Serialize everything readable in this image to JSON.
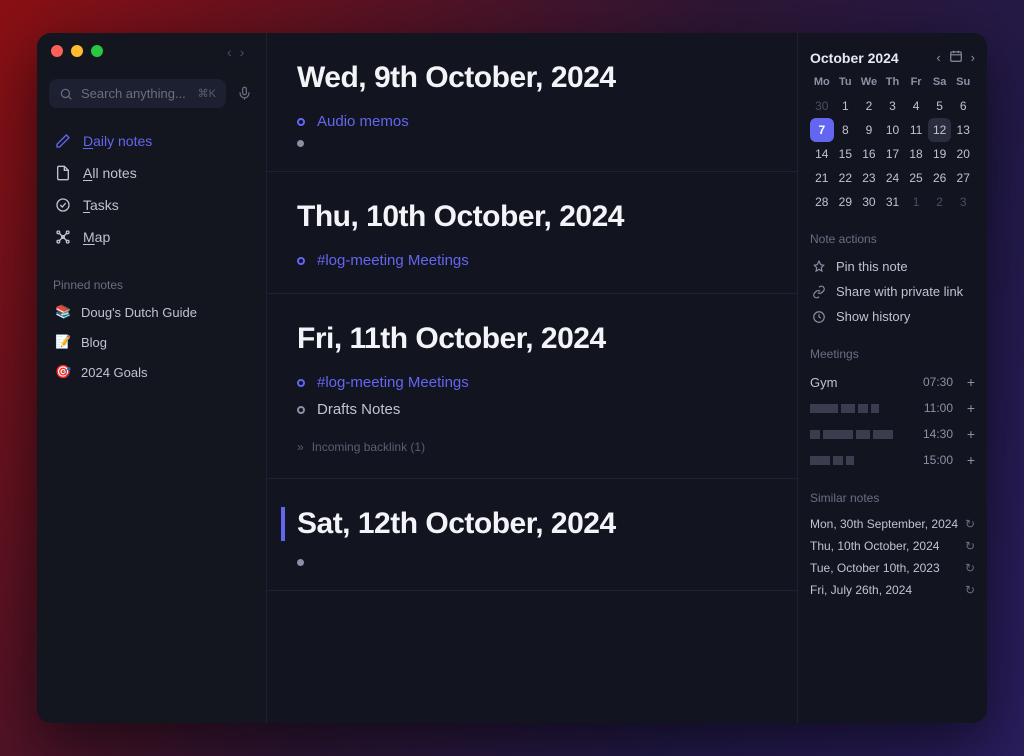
{
  "search": {
    "placeholder": "Search anything...",
    "kbd": "⌘K"
  },
  "nav": {
    "daily": "Daily notes",
    "all": "All notes",
    "tasks": "Tasks",
    "map": "Map"
  },
  "pinned": {
    "label": "Pinned notes",
    "items": [
      {
        "emoji": "📚",
        "label": "Doug's Dutch Guide"
      },
      {
        "emoji": "📝",
        "label": "Blog"
      },
      {
        "emoji": "🎯",
        "label": "2024 Goals"
      }
    ]
  },
  "days": [
    {
      "title": "Wed, 9th October, 2024",
      "bullets": [
        {
          "kind": "link",
          "text": "Audio memos"
        },
        {
          "kind": "empty"
        }
      ]
    },
    {
      "title": "Thu, 10th October, 2024",
      "bullets": [
        {
          "kind": "hashlink",
          "hash": "#log-meeting",
          "text": "Meetings"
        }
      ]
    },
    {
      "title": "Fri, 11th October, 2024",
      "bullets": [
        {
          "kind": "hashlink",
          "hash": "#log-meeting",
          "text": "Meetings"
        },
        {
          "kind": "text",
          "text": "Drafts Notes"
        }
      ],
      "backlinks": "Incoming backlink (1)"
    },
    {
      "title": "Sat, 12th October, 2024",
      "selected": true,
      "bullets": [
        {
          "kind": "empty"
        }
      ]
    }
  ],
  "calendar": {
    "month": "October 2024",
    "dow": [
      "Mo",
      "Tu",
      "We",
      "Th",
      "Fr",
      "Sa",
      "Su"
    ],
    "weeks": [
      [
        {
          "n": "30",
          "dim": true
        },
        {
          "n": "1"
        },
        {
          "n": "2"
        },
        {
          "n": "3"
        },
        {
          "n": "4"
        },
        {
          "n": "5"
        },
        {
          "n": "6"
        }
      ],
      [
        {
          "n": "7",
          "sel": true
        },
        {
          "n": "8"
        },
        {
          "n": "9"
        },
        {
          "n": "10"
        },
        {
          "n": "11"
        },
        {
          "n": "12",
          "today": true
        },
        {
          "n": "13"
        }
      ],
      [
        {
          "n": "14"
        },
        {
          "n": "15"
        },
        {
          "n": "16"
        },
        {
          "n": "17"
        },
        {
          "n": "18"
        },
        {
          "n": "19"
        },
        {
          "n": "20"
        }
      ],
      [
        {
          "n": "21"
        },
        {
          "n": "22"
        },
        {
          "n": "23"
        },
        {
          "n": "24"
        },
        {
          "n": "25"
        },
        {
          "n": "26"
        },
        {
          "n": "27"
        }
      ],
      [
        {
          "n": "28"
        },
        {
          "n": "29"
        },
        {
          "n": "30"
        },
        {
          "n": "31"
        },
        {
          "n": "1",
          "dim": true
        },
        {
          "n": "2",
          "dim": true
        },
        {
          "n": "3",
          "dim": true
        }
      ]
    ]
  },
  "note_actions": {
    "label": "Note actions",
    "pin": "Pin this note",
    "share": "Share with private link",
    "history": "Show history"
  },
  "meetings": {
    "label": "Meetings",
    "items": [
      {
        "name": "Gym",
        "time": "07:30",
        "redacted": false
      },
      {
        "name": "",
        "time": "11:00",
        "redacted": true,
        "blocks": [
          28,
          14,
          10,
          8
        ]
      },
      {
        "name": "",
        "time": "14:30",
        "redacted": true,
        "blocks": [
          10,
          30,
          14,
          20
        ]
      },
      {
        "name": "",
        "time": "15:00",
        "redacted": true,
        "blocks": [
          20,
          10,
          8
        ]
      }
    ]
  },
  "similar": {
    "label": "Similar notes",
    "items": [
      "Mon, 30th September, 2024",
      "Thu, 10th October, 2024",
      "Tue, October 10th, 2023",
      "Fri, July 26th, 2024"
    ]
  }
}
